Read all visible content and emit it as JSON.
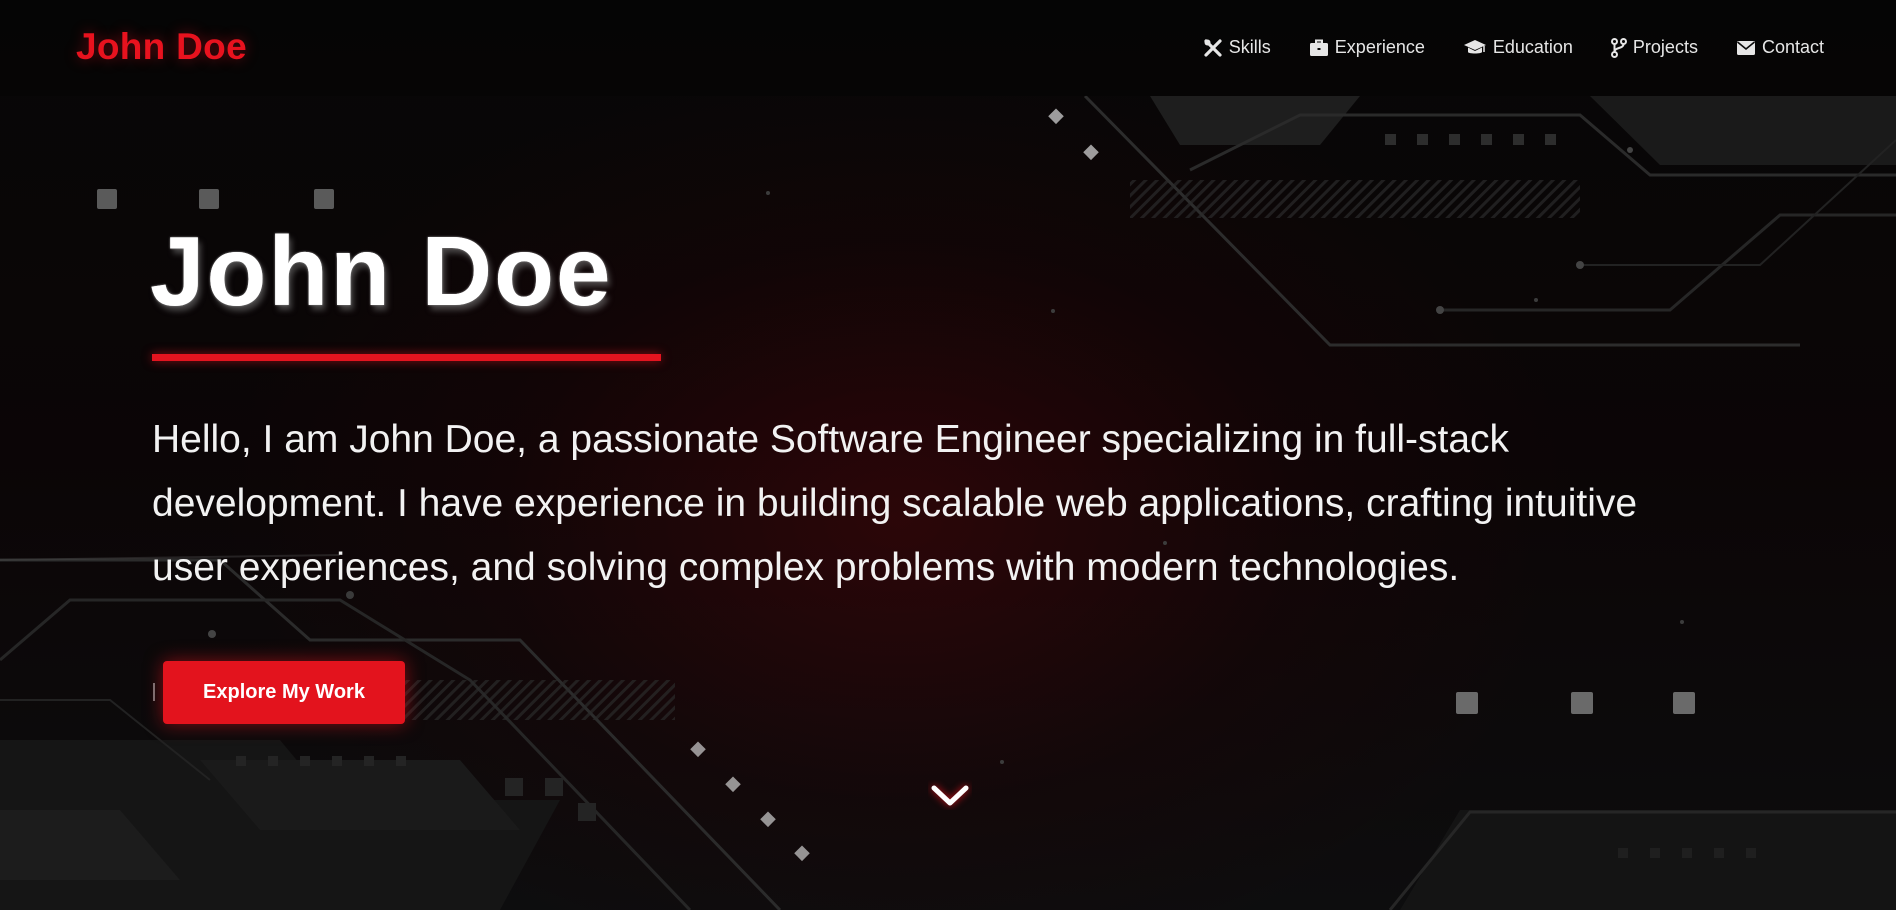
{
  "header": {
    "brand": "John Doe",
    "nav": [
      {
        "label": "Skills",
        "icon": "tools-icon"
      },
      {
        "label": "Experience",
        "icon": "briefcase-icon"
      },
      {
        "label": "Education",
        "icon": "graduation-cap-icon"
      },
      {
        "label": "Projects",
        "icon": "code-branch-icon"
      },
      {
        "label": "Contact",
        "icon": "envelope-icon"
      }
    ]
  },
  "hero": {
    "title": "John Doe",
    "description": "Hello, I am John Doe, a passionate Software Engineer specializing in full-stack development. I have experience in building scalable web applications, crafting intuitive user experiences, and solving complex problems with modern technologies.",
    "cta_label": "Explore My Work",
    "scroll_icon": "chevron-down-icon"
  },
  "colors": {
    "accent": "#e3131d",
    "background": "#050505",
    "text": "#f2f2f2"
  }
}
